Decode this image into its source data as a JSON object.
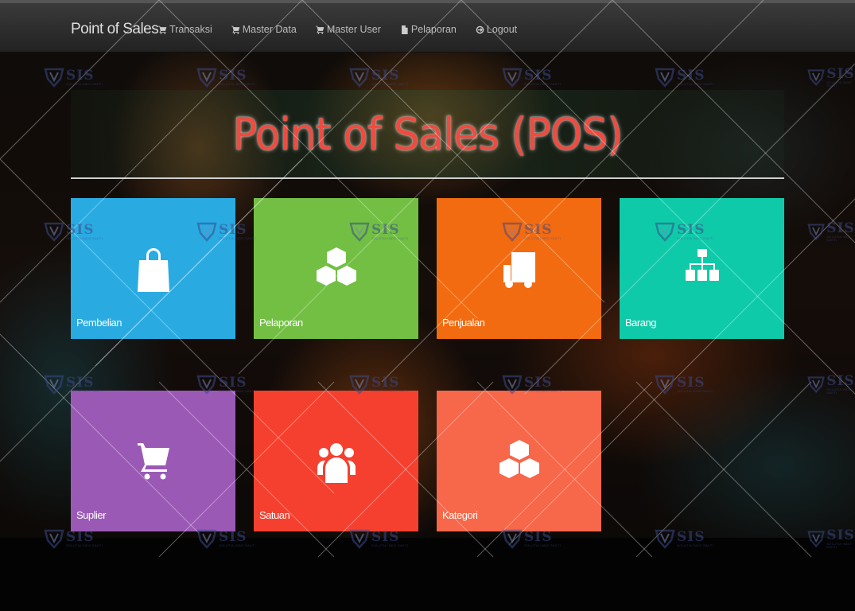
{
  "navbar": {
    "brand": "Point of Sales",
    "items": [
      {
        "label": "Transaksi",
        "icon": "cart-icon"
      },
      {
        "label": "Master Data",
        "icon": "cart-icon"
      },
      {
        "label": "Master User",
        "icon": "cart-icon"
      },
      {
        "label": "Pelaporan",
        "icon": "file-icon"
      },
      {
        "label": "Logout",
        "icon": "logout-icon"
      }
    ]
  },
  "hero": {
    "title": "Point of Sales (POS)"
  },
  "tiles": [
    {
      "label": "Pembelian",
      "icon": "shopping-bag-icon",
      "color": "#29abe2"
    },
    {
      "label": "Pelaporan",
      "icon": "cubes-icon",
      "color": "#72bf44"
    },
    {
      "label": "Penjualan",
      "icon": "truck-icon",
      "color": "#f26b10"
    },
    {
      "label": "Barang",
      "icon": "sitemap-icon",
      "color": "#0fcaa9"
    },
    {
      "label": "Suplier",
      "icon": "cart-icon",
      "color": "#9b59b6"
    },
    {
      "label": "Satuan",
      "icon": "users-icon",
      "color": "#f5402f"
    },
    {
      "label": "Kategori",
      "icon": "cubes-icon",
      "color": "#f7674a"
    }
  ],
  "watermark": {
    "text": "SIS",
    "subtext": "SOLUTIA INDO SAKTI"
  },
  "colors": {
    "title": "#ef4b3f",
    "navbar": "#2a2a2a"
  }
}
